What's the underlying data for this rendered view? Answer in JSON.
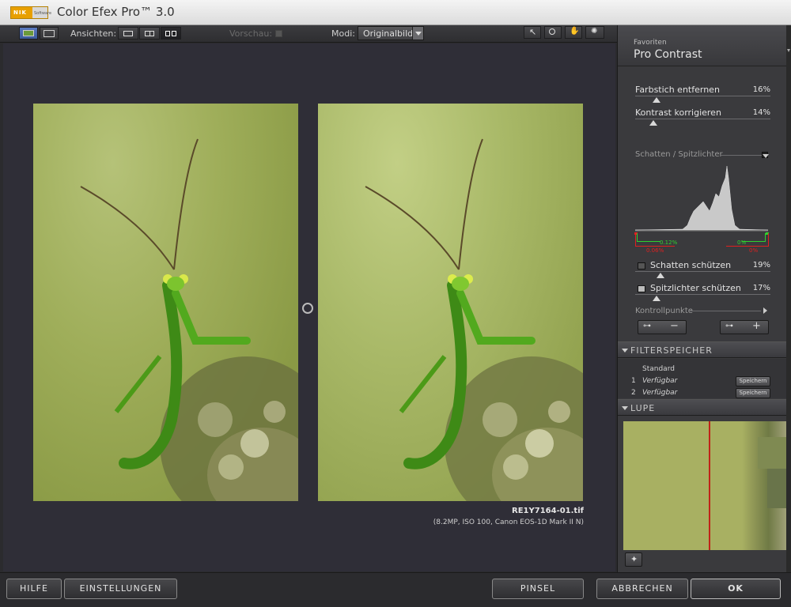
{
  "app": {
    "title": "Color Efex Pro™ 3.0",
    "logo_text": "NIK",
    "logo_sub": "Software"
  },
  "toolbar": {
    "views_label": "Ansichten:",
    "preview_label": "Vorschau:",
    "modes_label": "Modi:",
    "mode_value": "Originalbild"
  },
  "canvas": {
    "filename": "RE1Y7164-01.tif",
    "fileinfo": "(8.2MP, ISO 100, Canon EOS-1D Mark II N)"
  },
  "panel": {
    "category": "Favoriten",
    "filter_name": "Pro Contrast",
    "sliders": [
      {
        "label": "Farbstich entfernen",
        "value": "16%"
      },
      {
        "label": "Kontrast korrigieren",
        "value": "14%"
      }
    ],
    "shadows_section": "Schatten / Spitzlichter",
    "clip": {
      "shadow_green": "0.12%",
      "shadow_red": "0.06%",
      "highlight_green": "0%",
      "highlight_red": "0%"
    },
    "protect": [
      {
        "label": "Schatten schützen",
        "value": "19%"
      },
      {
        "label": "Spitzlichter schützen",
        "value": "17%"
      }
    ],
    "control_points": "Kontrollpunkte",
    "filter_memory": {
      "header": "FILTERSPEICHER",
      "standard": "Standard",
      "items": [
        {
          "num": "1",
          "label": "Verfügbar",
          "button": "Speichern"
        },
        {
          "num": "2",
          "label": "Verfügbar",
          "button": "Speichern"
        }
      ]
    },
    "loupe_header": "LUPE"
  },
  "bottom": {
    "help": "HILFE",
    "settings": "EINSTELLUNGEN",
    "brush": "PINSEL",
    "cancel": "ABBRECHEN",
    "ok": "OK"
  },
  "colors": {
    "clip_green": "#2fd12f",
    "clip_red": "#e02020",
    "loupe_line": "#c02418"
  }
}
